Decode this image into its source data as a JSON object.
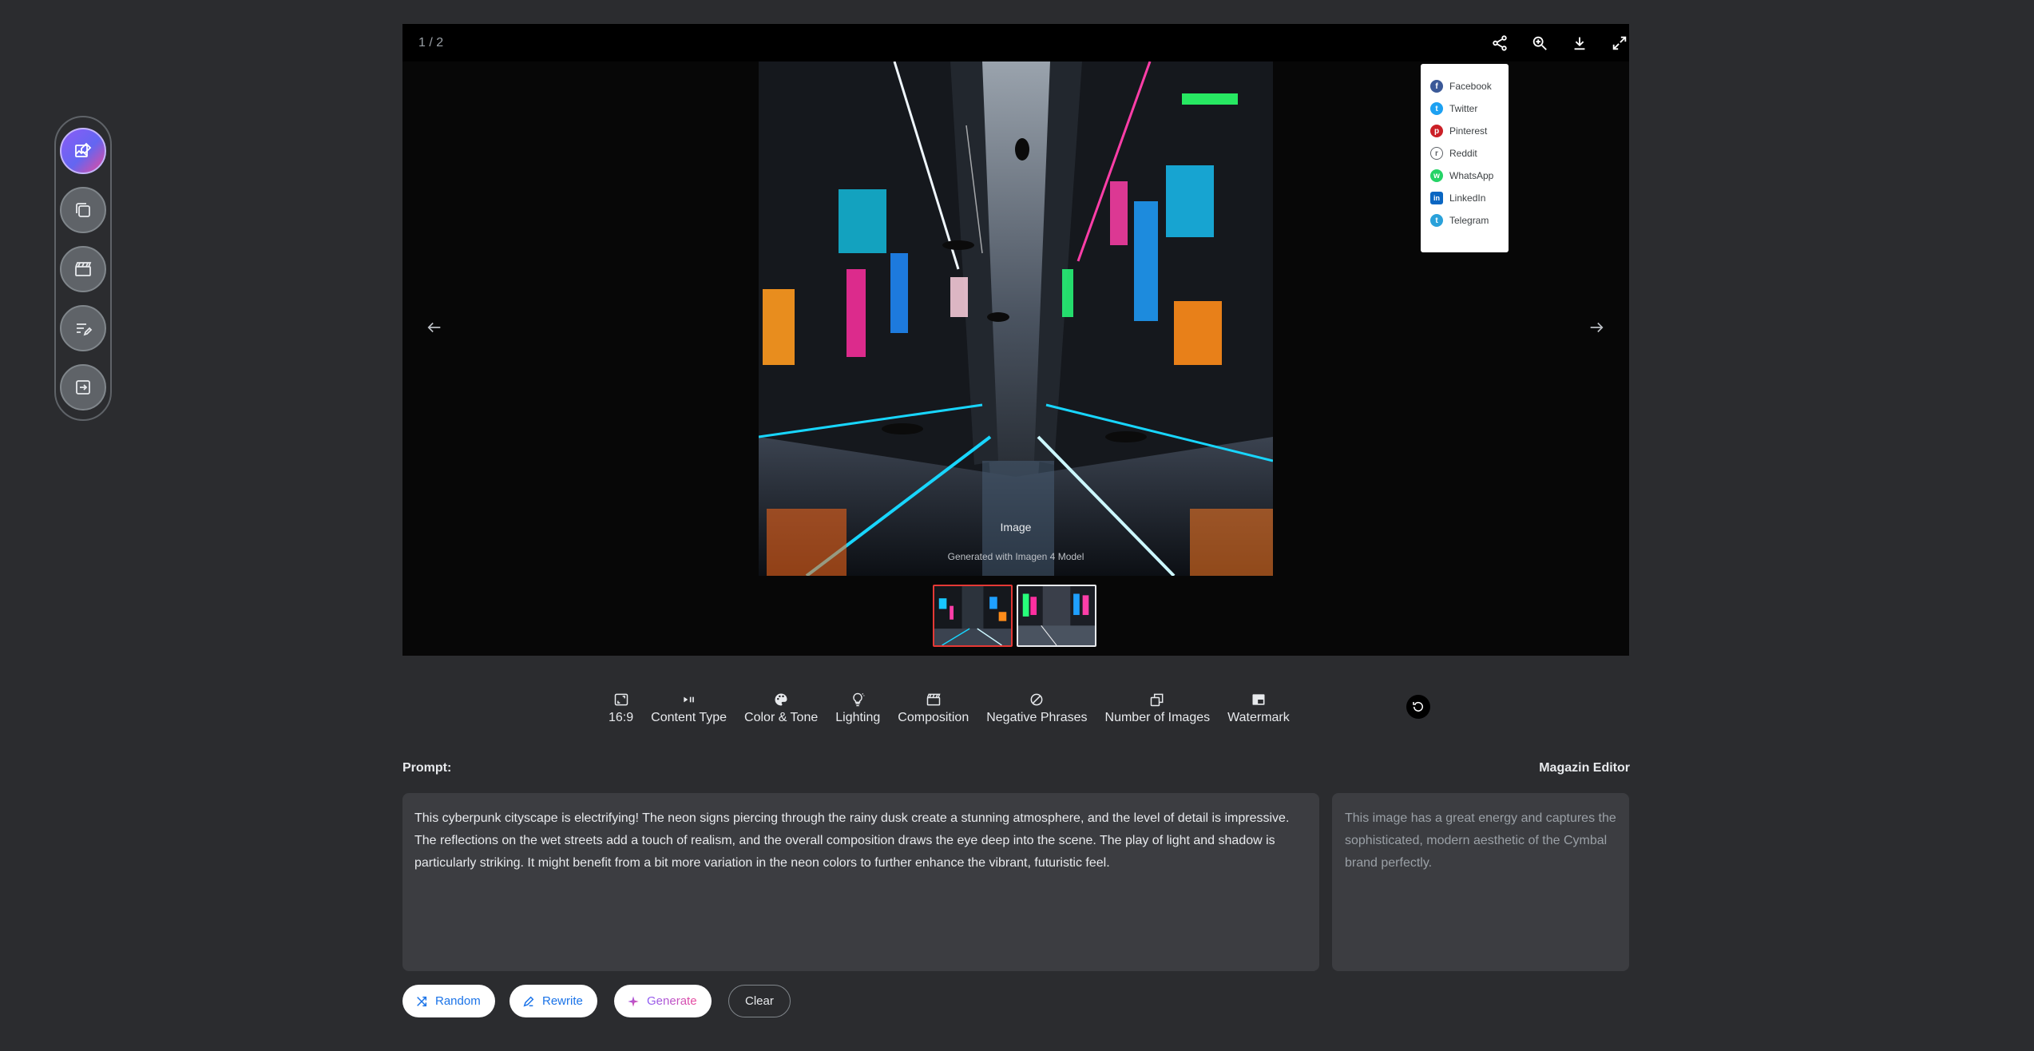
{
  "rail": {
    "items": [
      {
        "name": "image-edit",
        "icon": "image-edit-icon",
        "active": true
      },
      {
        "name": "image-remix",
        "icon": "image-remix-icon",
        "active": false
      },
      {
        "name": "storyboard",
        "icon": "clapperboard-icon",
        "active": false
      },
      {
        "name": "text-edit",
        "icon": "text-edit-icon",
        "active": false
      },
      {
        "name": "import",
        "icon": "import-icon",
        "active": false
      }
    ]
  },
  "viewer": {
    "counter": "1 / 2",
    "tools": [
      "share-icon",
      "zoom-icon",
      "download-icon",
      "fullscreen-icon"
    ],
    "share_menu": [
      {
        "label": "Facebook",
        "color": "#3b5998",
        "glyph": "f"
      },
      {
        "label": "Twitter",
        "color": "#1da1f2",
        "glyph": "t"
      },
      {
        "label": "Pinterest",
        "color": "#cb2027",
        "glyph": "p"
      },
      {
        "label": "Reddit",
        "color": "#ff4500",
        "glyph": "r"
      },
      {
        "label": "WhatsApp",
        "color": "#25d366",
        "glyph": "w"
      },
      {
        "label": "LinkedIn",
        "color": "#0a66c2",
        "glyph": "in"
      },
      {
        "label": "Telegram",
        "color": "#2aa1da",
        "glyph": "t"
      }
    ],
    "caption_title": "Image",
    "caption_sub": "Generated with Imagen 4 Model"
  },
  "options": [
    {
      "label": "16:9",
      "icon": "aspect-ratio-icon"
    },
    {
      "label": "Content Type",
      "icon": "content-type-icon"
    },
    {
      "label": "Color & Tone",
      "icon": "palette-icon"
    },
    {
      "label": "Lighting",
      "icon": "lightbulb-icon"
    },
    {
      "label": "Composition",
      "icon": "composition-icon"
    },
    {
      "label": "Negative Phrases",
      "icon": "block-icon"
    },
    {
      "label": "Number of Images",
      "icon": "images-stack-icon"
    },
    {
      "label": "Watermark",
      "icon": "watermark-icon"
    }
  ],
  "prompt": {
    "label": "Prompt:",
    "text": "This cyberpunk cityscape is electrifying! The neon signs piercing through the rainy dusk create a stunning atmosphere, and the level of detail is impressive.  The reflections on the wet streets add a touch of realism, and the overall composition draws the eye deep into the scene. The play of light and shadow is particularly striking. It might benefit from a bit more variation in the neon colors to further enhance the vibrant, futuristic feel."
  },
  "editor": {
    "label": "Magazin Editor",
    "text": "This image has a great energy and captures the sophisticated, modern aesthetic of the Cymbal brand perfectly."
  },
  "actions": {
    "random": "Random",
    "rewrite": "Rewrite",
    "generate": "Generate",
    "clear": "Clear"
  }
}
